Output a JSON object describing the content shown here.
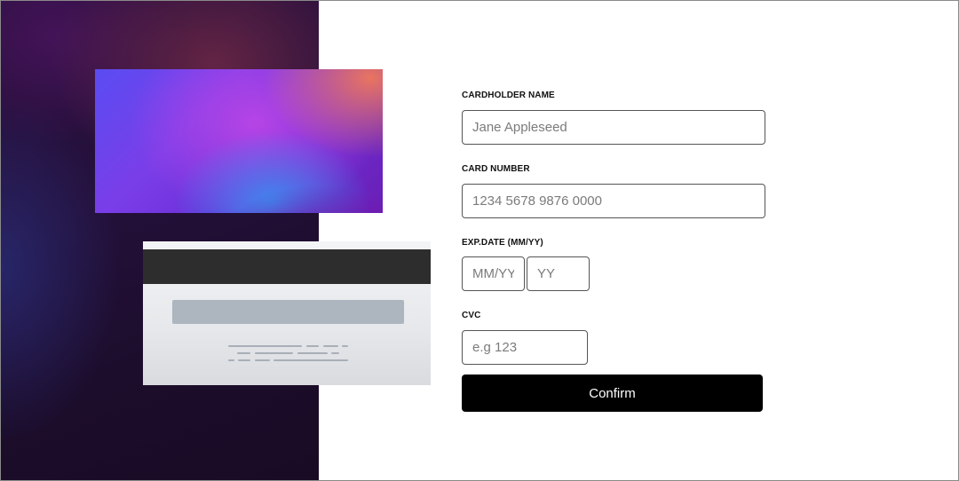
{
  "form": {
    "cardholder_label": "CARDHOLDER NAME",
    "cardholder_placeholder": "Jane Appleseed",
    "number_label": "CARD NUMBER",
    "number_placeholder": "1234 5678 9876 0000",
    "exp_label": "EXP.DATE (MM/YY)",
    "exp_month_placeholder": "MM/YY",
    "exp_year_placeholder": "YY",
    "cvc_label": "CVC",
    "cvc_placeholder": "e.g 123",
    "confirm_label": "Confirm"
  },
  "colors": {
    "button_bg": "#000000",
    "input_border": "#555555",
    "panel_bg": "#1c0d2c"
  }
}
